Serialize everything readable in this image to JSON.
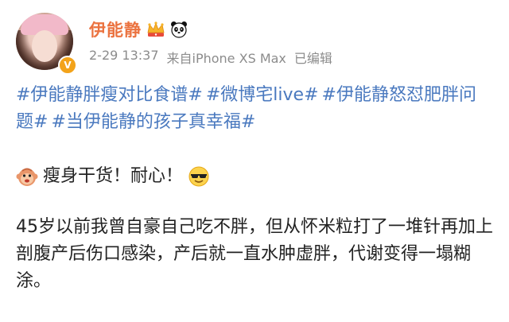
{
  "header": {
    "username": "伊能静",
    "timestamp": "2-29 13:37",
    "source": "来自iPhone XS Max",
    "edited": "已编辑",
    "icons": [
      "crown-icon",
      "panda-icon",
      "verified-icon"
    ],
    "verified_mark": "V"
  },
  "post": {
    "topics": [
      "#伊能静胖瘦对比食谱#",
      "#微博宅live#",
      "#伊能静怒怼肥胖问题#",
      "#当伊能静的孩子真幸福#"
    ],
    "dry_goods": "瘦身干货！耐心！",
    "body": "45岁以前我曾自豪自己吃不胖，但从怀米粒打了一堆针再加上剖腹产后伤口感染，产后就一直水肿虚胖，代谢变得一塌糊涂。"
  },
  "colors": {
    "username": "#eb7340",
    "topic": "#4a79bf",
    "meta": "#8c8c8c",
    "text": "#222222",
    "verified": "#f3a31a"
  }
}
